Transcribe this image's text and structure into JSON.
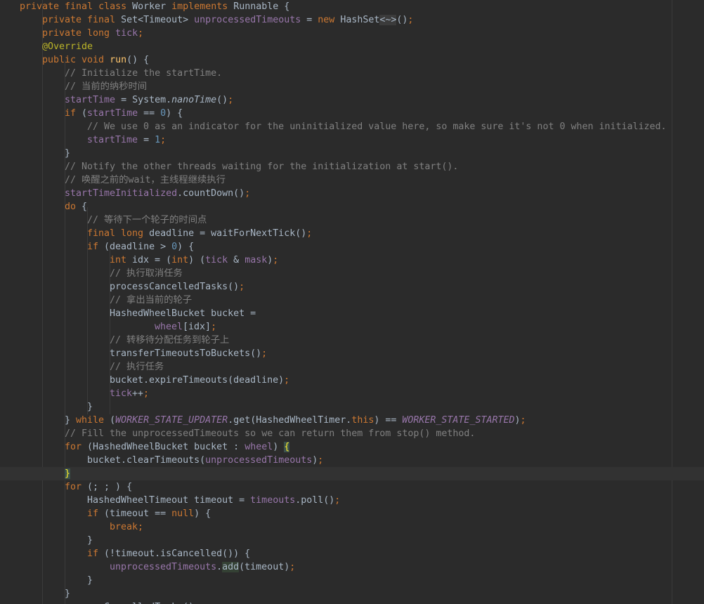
{
  "code_lines": [
    {
      "indent": 0,
      "tokens": [
        {
          "t": "private final class ",
          "c": "kw"
        },
        {
          "t": "Worker "
        },
        {
          "t": "implements ",
          "c": "kw"
        },
        {
          "t": "Runnable {"
        }
      ]
    },
    {
      "indent": 1,
      "tokens": [
        {
          "t": "private final ",
          "c": "kw"
        },
        {
          "t": "Set<Timeout> "
        },
        {
          "t": "unprocessedTimeouts",
          "c": "fld"
        },
        {
          "t": " = "
        },
        {
          "t": "new ",
          "c": "kw"
        },
        {
          "t": "HashSet"
        },
        {
          "t": "<~>",
          "c": "fold"
        },
        {
          "t": "()"
        },
        {
          "t": ";",
          "c": "kw"
        }
      ]
    },
    {
      "indent": 1,
      "tokens": [
        {
          "t": "private long ",
          "c": "kw"
        },
        {
          "t": "tick",
          "c": "fld"
        },
        {
          "t": ";",
          "c": "kw"
        }
      ]
    },
    {
      "indent": 1,
      "tokens": [
        {
          "t": "@Override",
          "c": "ann"
        }
      ]
    },
    {
      "indent": 1,
      "tokens": [
        {
          "t": "public void ",
          "c": "kw"
        },
        {
          "t": "run",
          "c": "mth"
        },
        {
          "t": "() {"
        }
      ]
    },
    {
      "indent": 2,
      "tokens": [
        {
          "t": "// Initialize the startTime.",
          "c": "com"
        }
      ]
    },
    {
      "indent": 2,
      "tokens": [
        {
          "t": "// 当前的纳秒时间",
          "c": "com"
        }
      ]
    },
    {
      "indent": 2,
      "tokens": [
        {
          "t": "startTime",
          "c": "fld"
        },
        {
          "t": " = System."
        },
        {
          "t": "nanoTime",
          "c": "smeth"
        },
        {
          "t": "()"
        },
        {
          "t": ";",
          "c": "kw"
        }
      ]
    },
    {
      "indent": 2,
      "tokens": [
        {
          "t": "if ",
          "c": "kw"
        },
        {
          "t": "("
        },
        {
          "t": "startTime",
          "c": "fld"
        },
        {
          "t": " == "
        },
        {
          "t": "0",
          "c": "num"
        },
        {
          "t": ") {"
        }
      ]
    },
    {
      "indent": 3,
      "tokens": [
        {
          "t": "// We use 0 as an indicator for the uninitialized value here, so make sure it's not 0 when initialized.",
          "c": "com"
        }
      ]
    },
    {
      "indent": 3,
      "tokens": [
        {
          "t": "startTime",
          "c": "fld"
        },
        {
          "t": " = "
        },
        {
          "t": "1",
          "c": "num"
        },
        {
          "t": ";",
          "c": "kw"
        }
      ]
    },
    {
      "indent": 2,
      "tokens": [
        {
          "t": "}"
        }
      ]
    },
    {
      "indent": 2,
      "tokens": [
        {
          "t": "// Notify the other threads waiting for the initialization at start().",
          "c": "com"
        }
      ]
    },
    {
      "indent": 2,
      "tokens": [
        {
          "t": "// 唤醒之前的wait，主线程继续执行",
          "c": "com"
        }
      ]
    },
    {
      "indent": 2,
      "tokens": [
        {
          "t": "startTimeInitialized",
          "c": "fld"
        },
        {
          "t": ".countDown()"
        },
        {
          "t": ";",
          "c": "kw"
        }
      ]
    },
    {
      "indent": 2,
      "tokens": [
        {
          "t": "do ",
          "c": "kw"
        },
        {
          "t": "{"
        }
      ]
    },
    {
      "indent": 3,
      "tokens": [
        {
          "t": "// 等待下一个轮子的时间点",
          "c": "com"
        }
      ]
    },
    {
      "indent": 3,
      "tokens": [
        {
          "t": "final long ",
          "c": "kw"
        },
        {
          "t": "deadline = waitForNextTick()"
        },
        {
          "t": ";",
          "c": "kw"
        }
      ]
    },
    {
      "indent": 3,
      "tokens": [
        {
          "t": "if ",
          "c": "kw"
        },
        {
          "t": "(deadline > "
        },
        {
          "t": "0",
          "c": "num"
        },
        {
          "t": ") {"
        }
      ]
    },
    {
      "indent": 4,
      "tokens": [
        {
          "t": "int ",
          "c": "kw"
        },
        {
          "t": "idx = ("
        },
        {
          "t": "int",
          "c": "kw"
        },
        {
          "t": ") ("
        },
        {
          "t": "tick",
          "c": "fld"
        },
        {
          "t": " & "
        },
        {
          "t": "mask",
          "c": "fld"
        },
        {
          "t": ")"
        },
        {
          "t": ";",
          "c": "kw"
        }
      ]
    },
    {
      "indent": 4,
      "tokens": [
        {
          "t": "// 执行取消任务",
          "c": "com"
        }
      ]
    },
    {
      "indent": 4,
      "tokens": [
        {
          "t": "processCancelledTasks()"
        },
        {
          "t": ";",
          "c": "kw"
        }
      ]
    },
    {
      "indent": 4,
      "tokens": [
        {
          "t": "// 拿出当前的轮子",
          "c": "com"
        }
      ]
    },
    {
      "indent": 4,
      "tokens": [
        {
          "t": "HashedWheelBucket bucket ="
        }
      ]
    },
    {
      "indent": 6,
      "tokens": [
        {
          "t": "wheel",
          "c": "fld"
        },
        {
          "t": "[idx]"
        },
        {
          "t": ";",
          "c": "kw"
        }
      ]
    },
    {
      "indent": 4,
      "tokens": [
        {
          "t": "// 转移待分配任务到轮子上",
          "c": "com"
        }
      ]
    },
    {
      "indent": 4,
      "tokens": [
        {
          "t": "transferTimeoutsToBuckets()"
        },
        {
          "t": ";",
          "c": "kw"
        }
      ]
    },
    {
      "indent": 4,
      "tokens": [
        {
          "t": "// 执行任务",
          "c": "com"
        }
      ]
    },
    {
      "indent": 4,
      "tokens": [
        {
          "t": "bucket.expireTimeouts(deadline)"
        },
        {
          "t": ";",
          "c": "kw"
        }
      ]
    },
    {
      "indent": 4,
      "tokens": [
        {
          "t": "tick",
          "c": "fld"
        },
        {
          "t": "++"
        },
        {
          "t": ";",
          "c": "kw"
        }
      ]
    },
    {
      "indent": 3,
      "tokens": [
        {
          "t": "}"
        }
      ]
    },
    {
      "indent": 2,
      "tokens": [
        {
          "t": "} "
        },
        {
          "t": "while ",
          "c": "kw"
        },
        {
          "t": "("
        },
        {
          "t": "WORKER_STATE_UPDATER",
          "c": "sfld"
        },
        {
          "t": ".get(HashedWheelTimer."
        },
        {
          "t": "this",
          "c": "kw"
        },
        {
          "t": ") == "
        },
        {
          "t": "WORKER_STATE_STARTED",
          "c": "sfld"
        },
        {
          "t": ")"
        },
        {
          "t": ";",
          "c": "kw"
        }
      ]
    },
    {
      "indent": 2,
      "tokens": [
        {
          "t": "// Fill the unprocessedTimeouts so we can return them from stop() method.",
          "c": "com"
        }
      ]
    },
    {
      "indent": 2,
      "tokens": [
        {
          "t": "for ",
          "c": "kw"
        },
        {
          "t": "(HashedWheelBucket bucket : "
        },
        {
          "t": "wheel",
          "c": "fld"
        },
        {
          "t": ") "
        },
        {
          "t": "{",
          "c": "brace"
        }
      ]
    },
    {
      "indent": 3,
      "tokens": [
        {
          "t": "bucket.clearTimeouts("
        },
        {
          "t": "unprocessedTimeouts",
          "c": "fld"
        },
        {
          "t": ")"
        },
        {
          "t": ";",
          "c": "kw"
        }
      ]
    },
    {
      "indent": 2,
      "current": true,
      "tokens": [
        {
          "t": "}",
          "c": "brace"
        }
      ]
    },
    {
      "indent": 2,
      "tokens": [
        {
          "t": "for ",
          "c": "kw"
        },
        {
          "t": "(; ; ) {"
        }
      ]
    },
    {
      "indent": 3,
      "tokens": [
        {
          "t": "HashedWheelTimeout timeout = "
        },
        {
          "t": "timeouts",
          "c": "fld"
        },
        {
          "t": ".poll()"
        },
        {
          "t": ";",
          "c": "kw"
        }
      ]
    },
    {
      "indent": 3,
      "tokens": [
        {
          "t": "if ",
          "c": "kw"
        },
        {
          "t": "(timeout == "
        },
        {
          "t": "null",
          "c": "kw"
        },
        {
          "t": ") {"
        }
      ]
    },
    {
      "indent": 4,
      "tokens": [
        {
          "t": "break;",
          "c": "kw"
        }
      ]
    },
    {
      "indent": 3,
      "tokens": [
        {
          "t": "}"
        }
      ]
    },
    {
      "indent": 3,
      "tokens": [
        {
          "t": "if ",
          "c": "kw"
        },
        {
          "t": "(!timeout.isCancelled()) {"
        }
      ]
    },
    {
      "indent": 4,
      "tokens": [
        {
          "t": "unprocessedTimeouts",
          "c": "fld"
        },
        {
          "t": "."
        },
        {
          "t": "add",
          "c": "usage"
        },
        {
          "t": "(timeout)"
        },
        {
          "t": ";",
          "c": "kw"
        }
      ]
    },
    {
      "indent": 3,
      "tokens": [
        {
          "t": "}"
        }
      ]
    },
    {
      "indent": 2,
      "tokens": [
        {
          "t": "}"
        }
      ]
    },
    {
      "indent": 2,
      "tokens": [
        {
          "t": "processCancelledTasks()"
        },
        {
          "t": ";",
          "c": "kw"
        }
      ]
    }
  ]
}
